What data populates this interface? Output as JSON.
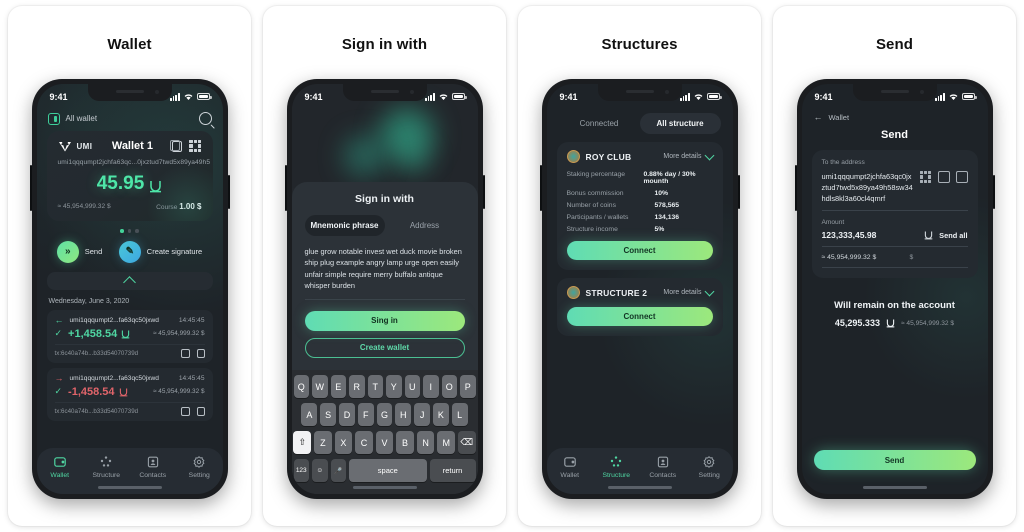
{
  "cards": [
    {
      "title": "Wallet"
    },
    {
      "title": "Sign in with"
    },
    {
      "title": "Structures"
    },
    {
      "title": "Send"
    }
  ],
  "status_bar": {
    "time": "9:41"
  },
  "wallet_screen": {
    "all_wallet_label": "All wallet",
    "brand": "UMI",
    "wallet_name": "Wallet 1",
    "address": "umi1qqqumpt2jchfa63qc...0jxztud7twd5x89ya49h5",
    "balance": "45.95",
    "balance_fiat": "≈ 45,954,999.32 $",
    "course_label": "Course",
    "course_value": "1.00 $",
    "actions": [
      {
        "label": "Send",
        "icon": "send-icon"
      },
      {
        "label": "Create signature",
        "icon": "pencil-icon"
      }
    ],
    "tx_date": "Wednesday, June 3, 2020",
    "transactions": [
      {
        "direction": "in",
        "address": "umi1qqqumpt2...fa63qc50jxwd",
        "time": "14:45:45",
        "amount": "+1,458.54",
        "fiat": "≈ 45,954,999.32 $",
        "hash": "tx:6c40a74b...b33d54070739d"
      },
      {
        "direction": "out",
        "address": "umi1qqqumpt2...fa63qc50jxwd",
        "time": "14:45:45",
        "amount": "-1,458.54",
        "fiat": "≈ 45,954,999.32 $",
        "hash": "tx:6c40a74b...b33d54070739d"
      }
    ],
    "tabbar": [
      {
        "label": "Wallet",
        "icon": "wallet-icon",
        "active": true
      },
      {
        "label": "Structure",
        "icon": "structure-icon",
        "active": false
      },
      {
        "label": "Contacts",
        "icon": "contacts-icon",
        "active": false
      },
      {
        "label": "Setting",
        "icon": "gear-icon",
        "active": false
      }
    ]
  },
  "signin_screen": {
    "sheet_title": "Sign in with",
    "segments": [
      {
        "label": "Mnemonic phrase",
        "active": true
      },
      {
        "label": "Address",
        "active": false
      }
    ],
    "mnemonic": "glue grow notable invest wet duck movie broken ship plug example angry lamp urge open easily unfair simple require merry buffalo antique whisper burden",
    "primary_button": "Sing in",
    "secondary_button": "Create wallet",
    "keyboard": {
      "row1": [
        "Q",
        "W",
        "E",
        "R",
        "T",
        "Y",
        "U",
        "I",
        "O",
        "P"
      ],
      "row2": [
        "A",
        "S",
        "D",
        "F",
        "G",
        "H",
        "J",
        "K",
        "L"
      ],
      "row3": [
        "⇧",
        "Z",
        "X",
        "C",
        "V",
        "B",
        "N",
        "M",
        "⌫"
      ],
      "row4": [
        "123",
        "☺",
        "🎤",
        "space",
        "return"
      ]
    }
  },
  "structures_screen": {
    "segments": [
      {
        "label": "Connected",
        "active": false
      },
      {
        "label": "All structure",
        "active": true
      }
    ],
    "more_details_label": "More details",
    "structures": [
      {
        "name": "ROY CLUB",
        "expanded": true,
        "rows": [
          {
            "key": "Staking percentage",
            "value": "0.88% day / 30% mounth"
          },
          {
            "key": "Bonus commission",
            "value": "10%"
          },
          {
            "key": "Number of coins",
            "value": "578,565"
          },
          {
            "key": "Participants / wallets",
            "value": "134,136"
          },
          {
            "key": "Structure income",
            "value": "5%"
          }
        ],
        "button": "Connect"
      },
      {
        "name": "STRUCTURE 2",
        "expanded": false,
        "rows": [],
        "button": "Connect"
      }
    ],
    "tabbar": [
      {
        "label": "Wallet",
        "icon": "wallet-icon",
        "active": false
      },
      {
        "label": "Structure",
        "icon": "structure-icon",
        "active": true
      },
      {
        "label": "Contacts",
        "icon": "contacts-icon",
        "active": false
      },
      {
        "label": "Setting",
        "icon": "gear-icon",
        "active": false
      }
    ]
  },
  "send_screen": {
    "back_label": "Wallet",
    "title": "Send",
    "address_label": "To the address",
    "address_value": "umi1qqqumpt2jchfa63qc0jxztud7twd5x89ya49h58sw34hdls8kl3a60cl4qmrf",
    "address_icons": [
      "qr-scan-icon",
      "contacts-icon",
      "wallet-icon"
    ],
    "amount_label": "Amount",
    "amount_value": "123,333,45.98",
    "send_all_label": "Send all",
    "amount_fiat": "≈ 45,954,999.32 $",
    "currency_symbol": "$",
    "remain_label": "Will remain on the account",
    "remain_value": "45,295.333",
    "remain_fiat": "≈ 45,954,999.32 $",
    "send_button": "Send"
  },
  "colors": {
    "accent_green": "#4fd6a2",
    "accent_gradient_start": "#5fdcb4",
    "accent_gradient_end": "#9ce87c",
    "negative_red": "#e0646a",
    "screen_bg": "#1e2328",
    "card_bg": "#242a30"
  }
}
